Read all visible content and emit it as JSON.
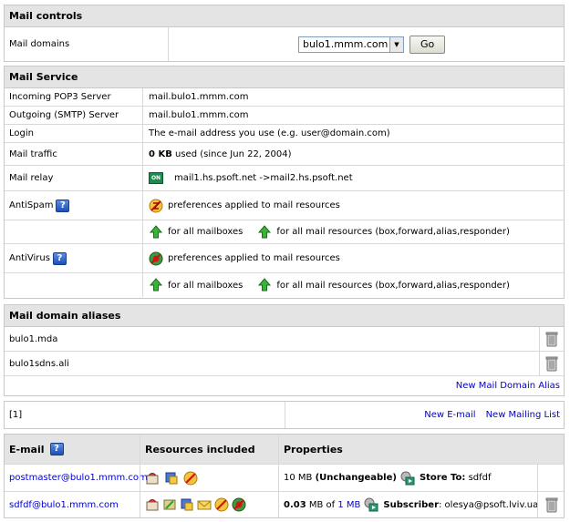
{
  "mail_controls": {
    "title": "Mail controls",
    "domains_label": "Mail domains",
    "selected_domain": "bulo1.mmm.com",
    "go_label": "Go"
  },
  "mail_service": {
    "title": "Mail Service",
    "rows": {
      "pop3_label": "Incoming POP3 Server",
      "pop3_value": "mail.bulo1.mmm.com",
      "smtp_label": "Outgoing (SMTP) Server",
      "smtp_value": "mail.bulo1.mmm.com",
      "login_label": "Login",
      "login_value": "The e-mail address you use (e.g. user@domain.com)",
      "traffic_label": "Mail traffic",
      "traffic_amount": "0 KB",
      "traffic_rest": "used (since Jun 22, 2004)",
      "relay_label": "Mail relay",
      "relay_badge": "ON",
      "relay_value": "mail1.hs.psoft.net ->mail2.hs.psoft.net",
      "antispam_label": "AntiSpam",
      "antispam_pref": "preferences applied to mail resources",
      "antivirus_label": "AntiVirus",
      "antivirus_pref": "preferences applied to mail resources",
      "for_all_mailboxes": "for all mailboxes",
      "for_all_resources": "for all mail resources (box,forward,alias,responder)"
    }
  },
  "aliases": {
    "title": "Mail domain aliases",
    "items": [
      "bulo1.mda",
      "bulo1sdns.ali"
    ],
    "new_alias": "New Mail Domain Alias"
  },
  "pager": {
    "page": "[1]",
    "new_email": "New E-mail",
    "new_list": "New Mailing List"
  },
  "email_table": {
    "headers": [
      "E-mail",
      "Resources included",
      "Properties"
    ],
    "rows": [
      {
        "email": "postmaster@bulo1.mmm.com",
        "size": "10 MB",
        "quota": "(Unchangeable)",
        "prop_label": "Store To:",
        "prop_value": "sdfdf"
      },
      {
        "email": "sdfdf@bulo1.mmm.com",
        "used": "0.03",
        "of_text": "MB of",
        "quota": "1 MB",
        "prop_label": "Subscriber",
        "prop_value": ": olesya@psoft.lviv.ua"
      }
    ]
  },
  "colors": {
    "header_bg": "#e4e4e4",
    "link": "#0000cc",
    "border": "#c8c8c8"
  }
}
